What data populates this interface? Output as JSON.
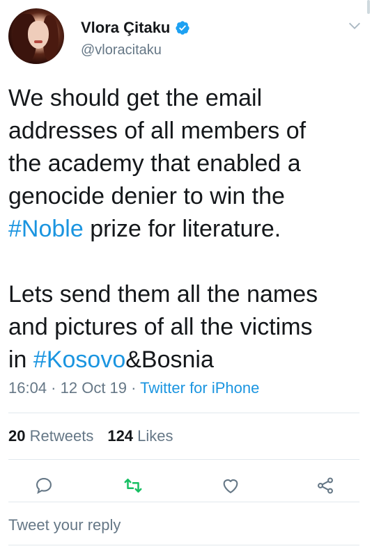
{
  "author": {
    "name": "Vlora Çitaku",
    "handle": "@vloracitaku"
  },
  "tweet": {
    "line1": "We should get the email",
    "line2": "addresses of all members of",
    "line3": "the academy that enabled a",
    "line4": "genocide denier to win the",
    "hashtag_noble": "#Noble",
    "line5_rest": " prize for literature.",
    "line6": "Lets send them all the names",
    "line7": "and pictures of all the victims",
    "line8_prefix": "in ",
    "hashtag_kosovo": "#Kosovo",
    "line8_suffix": "&Bosnia"
  },
  "meta": {
    "time": "16:04",
    "date": "12 Oct 19",
    "source": "Twitter for iPhone",
    "separator": " · "
  },
  "stats": {
    "retweets_count": "20",
    "retweets_label": "Retweets",
    "likes_count": "124",
    "likes_label": "Likes"
  },
  "reply": {
    "placeholder": "Tweet your reply"
  },
  "colors": {
    "link": "#1b95e0",
    "retweet": "#17bf63",
    "muted": "#657786"
  }
}
